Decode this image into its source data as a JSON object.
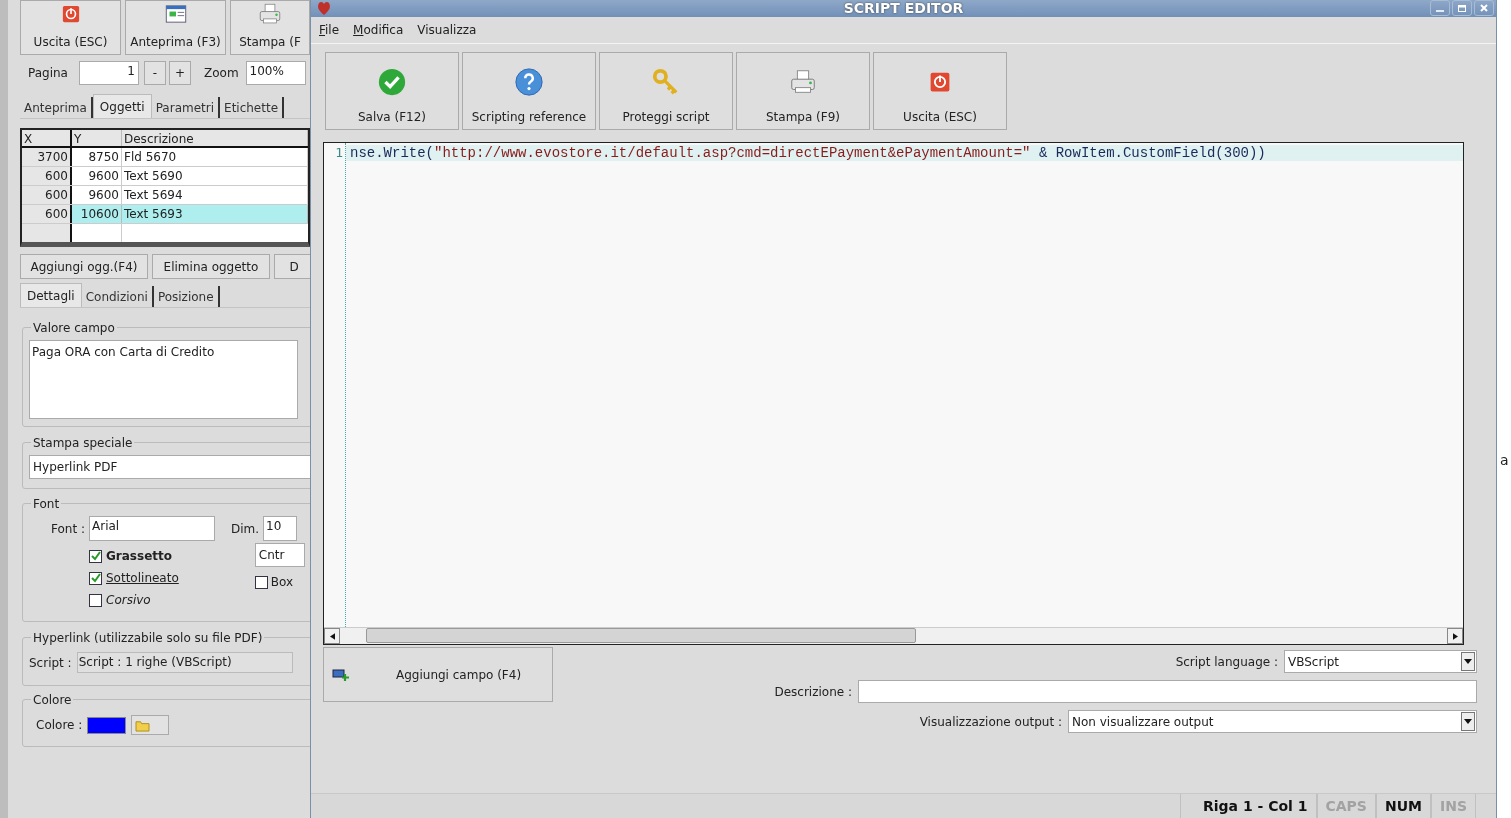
{
  "background_app": {
    "toolbar": [
      {
        "label": "Uscita (ESC)"
      },
      {
        "label": "Anteprima (F3)"
      },
      {
        "label": "Stampa (F"
      }
    ],
    "pager": {
      "label": "Pagina",
      "value": "1",
      "minus": "-",
      "plus": "+",
      "zoom_label": "Zoom",
      "zoom_value": "100%"
    },
    "tabs": [
      {
        "label": "Anteprima",
        "selected": false
      },
      {
        "label": "Oggetti",
        "selected": true
      },
      {
        "label": "Parametri",
        "selected": false
      },
      {
        "label": "Etichette",
        "selected": false
      }
    ],
    "table": {
      "columns": [
        "X",
        "Y",
        "Descrizione"
      ],
      "rows": [
        {
          "cells": [
            "3700",
            "8750",
            "Fld 5670"
          ],
          "selected": false
        },
        {
          "cells": [
            "600",
            "9600",
            "Text 5690"
          ],
          "selected": false
        },
        {
          "cells": [
            "600",
            "9600",
            "Text 5694"
          ],
          "selected": false
        },
        {
          "cells": [
            "600",
            "10600",
            "Text 5693"
          ],
          "selected": true
        }
      ]
    },
    "buttons": [
      "Aggiungi ogg.(F4)",
      "Elimina oggetto",
      "D"
    ],
    "detail_tabs": [
      {
        "label": "Dettagli",
        "selected": true
      },
      {
        "label": "Condizioni",
        "selected": false
      },
      {
        "label": "Posizione",
        "selected": false
      }
    ],
    "valore_campo": {
      "title": "Valore campo",
      "value": "Paga ORA con Carta di Credito"
    },
    "stampa_speciale": {
      "title": "Stampa speciale",
      "value": "Hyperlink PDF"
    },
    "font": {
      "title": "Font",
      "font_label": "Font :",
      "font_value": "Arial",
      "dim_label": "Dim.",
      "dim_value": "10",
      "align_value": "Cntr",
      "options": [
        {
          "label": "Grassetto",
          "checked": true,
          "kind": "bold"
        },
        {
          "label": "Sottolineato",
          "checked": true,
          "kind": "underline"
        },
        {
          "label": "Corsivo",
          "checked": false,
          "kind": "italic"
        }
      ],
      "box": {
        "label": "Box",
        "checked": false
      }
    },
    "hyperlink": {
      "title": "Hyperlink (utilizzabile solo su file PDF)",
      "script_label": "Script :",
      "script_value": "Script : 1 righe (VBScript)"
    },
    "colore": {
      "title": "Colore",
      "label": "Colore :",
      "color": "#0000ff"
    }
  },
  "edge_text": "a",
  "editor": {
    "title": "SCRIPT EDITOR",
    "menu": [
      {
        "label": "File",
        "underline_first": true
      },
      {
        "label": "Modifica",
        "underline_first": true
      },
      {
        "label": "Visualizza",
        "underline_first": false
      }
    ],
    "toolbar": [
      {
        "label": "Salva (F12)"
      },
      {
        "label": "Scripting reference"
      },
      {
        "label": "Proteggi script"
      },
      {
        "label": "Stampa (F9)"
      },
      {
        "label": "Uscita (ESC)"
      }
    ],
    "code": {
      "line_number": "1",
      "tokens": [
        {
          "text": "nse.Write(",
          "kind": "plain"
        },
        {
          "text": "\"http://www.evostore.it/default.asp?cmd=directEPayment&ePaymentAmount=\"",
          "kind": "string"
        },
        {
          "text": " & RowItem.CustomField(300))",
          "kind": "plain"
        }
      ]
    },
    "add_field_button": "Aggiungi campo (F4)",
    "script_language": {
      "label": "Script language :",
      "value": "VBScript"
    },
    "descrizione": {
      "label": "Descrizione :"
    },
    "output": {
      "label": "Visualizzazione output :",
      "value": "Non visualizzare output"
    },
    "status_bar": [
      {
        "text": "Riga 1 - Col 1",
        "disabled": false
      },
      {
        "text": "CAPS",
        "disabled": true
      },
      {
        "text": "NUM",
        "disabled": false
      },
      {
        "text": "INS",
        "disabled": true
      }
    ]
  }
}
